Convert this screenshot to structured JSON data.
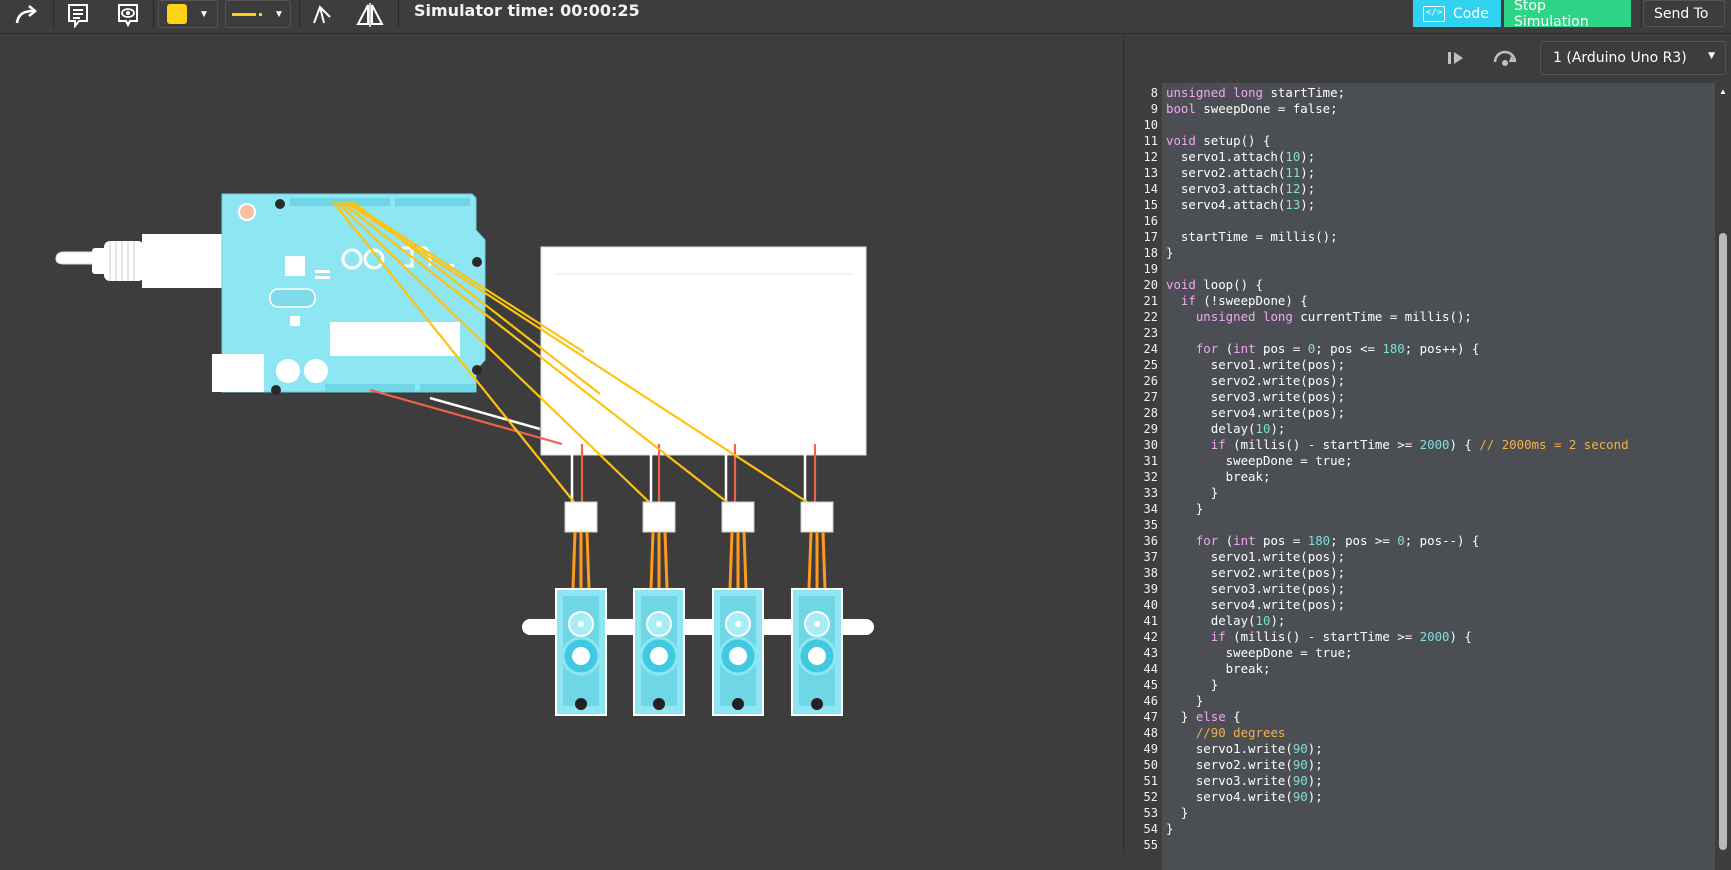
{
  "toolbar": {
    "simulator_time": "Simulator time: 00:00:25",
    "code_label": "Code",
    "stop_label": "Stop Simulation",
    "send_label": "Send To",
    "icons": [
      "redo-icon",
      "notes-icon",
      "visibility-icon",
      "color-swatch-icon",
      "line-style-icon",
      "rotate-icon",
      "flip-icon"
    ],
    "colors": {
      "code": "#2fd3f0",
      "stop": "#2ed587",
      "swatch": "#ffd21a"
    }
  },
  "code_panel": {
    "board_selected": "1 (Arduino Uno R3)",
    "icons": [
      "step-icon",
      "debug-icon",
      "chevron-down-icon"
    ]
  },
  "code_lines": [
    {
      "n": "8",
      "t": "unsigned long startTime;"
    },
    {
      "n": "9",
      "t": "bool sweepDone = false;"
    },
    {
      "n": "10",
      "t": ""
    },
    {
      "n": "11",
      "t": "void setup() {"
    },
    {
      "n": "12",
      "t": "  servo1.attach(10);"
    },
    {
      "n": "13",
      "t": "  servo2.attach(11);"
    },
    {
      "n": "14",
      "t": "  servo3.attach(12);"
    },
    {
      "n": "15",
      "t": "  servo4.attach(13);"
    },
    {
      "n": "16",
      "t": ""
    },
    {
      "n": "17",
      "t": "  startTime = millis();"
    },
    {
      "n": "18",
      "t": "}"
    },
    {
      "n": "19",
      "t": ""
    },
    {
      "n": "20",
      "t": "void loop() {"
    },
    {
      "n": "21",
      "t": "  if (!sweepDone) {"
    },
    {
      "n": "22",
      "t": "    unsigned long currentTime = millis();"
    },
    {
      "n": "23",
      "t": ""
    },
    {
      "n": "24",
      "t": "    for (int pos = 0; pos <= 180; pos++) {"
    },
    {
      "n": "25",
      "t": "      servo1.write(pos);"
    },
    {
      "n": "26",
      "t": "      servo2.write(pos);"
    },
    {
      "n": "27",
      "t": "      servo3.write(pos);"
    },
    {
      "n": "28",
      "t": "      servo4.write(pos);"
    },
    {
      "n": "29",
      "t": "      delay(10);"
    },
    {
      "n": "30",
      "t": "      if (millis() - startTime >= 2000) { // 2000ms = 2 second"
    },
    {
      "n": "31",
      "t": "        sweepDone = true;"
    },
    {
      "n": "32",
      "t": "        break;"
    },
    {
      "n": "33",
      "t": "      }"
    },
    {
      "n": "34",
      "t": "    }"
    },
    {
      "n": "35",
      "t": ""
    },
    {
      "n": "36",
      "t": "    for (int pos = 180; pos >= 0; pos--) {"
    },
    {
      "n": "37",
      "t": "      servo1.write(pos);"
    },
    {
      "n": "38",
      "t": "      servo2.write(pos);"
    },
    {
      "n": "39",
      "t": "      servo3.write(pos);"
    },
    {
      "n": "40",
      "t": "      servo4.write(pos);"
    },
    {
      "n": "41",
      "t": "      delay(10);"
    },
    {
      "n": "42",
      "t": "      if (millis() - startTime >= 2000) {"
    },
    {
      "n": "43",
      "t": "        sweepDone = true;"
    },
    {
      "n": "44",
      "t": "        break;"
    },
    {
      "n": "45",
      "t": "      }"
    },
    {
      "n": "46",
      "t": "    }"
    },
    {
      "n": "47",
      "t": "  } else {"
    },
    {
      "n": "48",
      "t": "    //90 degrees"
    },
    {
      "n": "49",
      "t": "    servo1.write(90);"
    },
    {
      "n": "50",
      "t": "    servo2.write(90);"
    },
    {
      "n": "51",
      "t": "    servo3.write(90);"
    },
    {
      "n": "52",
      "t": "    servo4.write(90);"
    },
    {
      "n": "53",
      "t": "  }"
    },
    {
      "n": "54",
      "t": "}"
    },
    {
      "n": "55",
      "t": ""
    }
  ],
  "circuit": {
    "components": [
      "arduino-uno-board",
      "usb-cable",
      "breadboard",
      "servo-1",
      "servo-2",
      "servo-3",
      "servo-4"
    ],
    "wire_colors": {
      "signal": "#ffc20e",
      "power": "#f0604a",
      "ground": "#ffffff"
    }
  }
}
